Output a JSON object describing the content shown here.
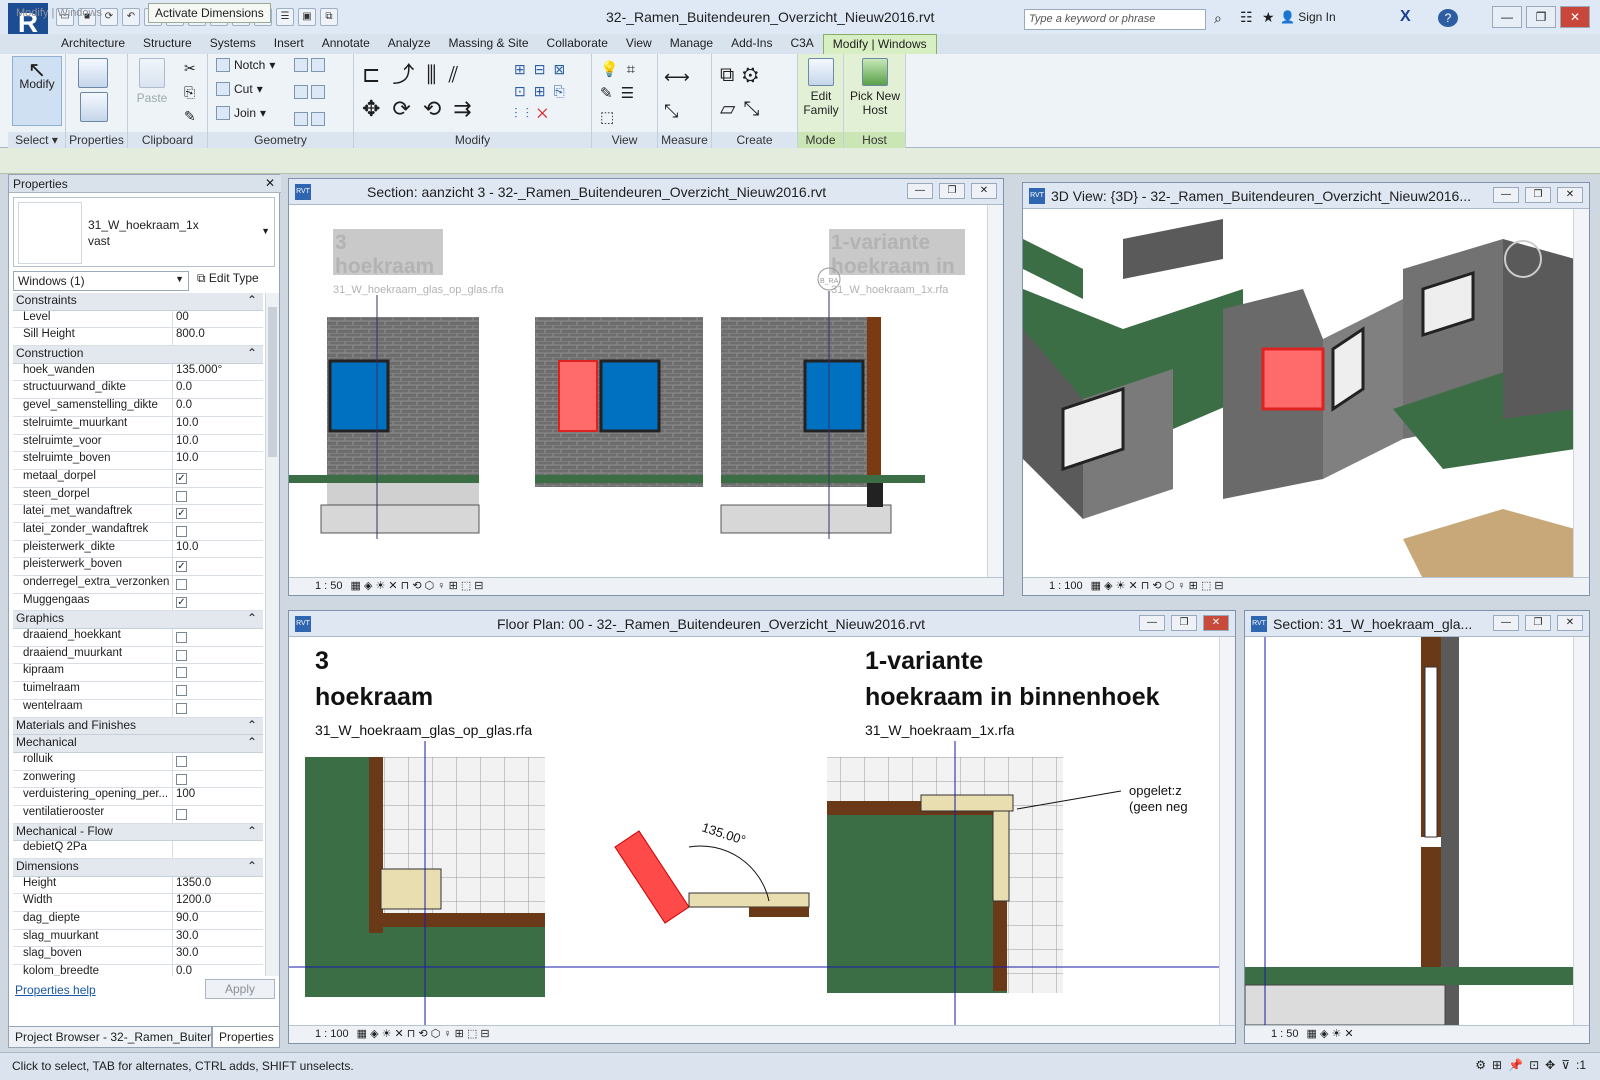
{
  "app": {
    "logo_letter": "R",
    "doc_title": "32-_Ramen_Buitendeuren_Overzicht_Nieuw2016.rvt",
    "search_placeholder": "Type a keyword or phrase",
    "sign_in": "Sign In",
    "help": "?"
  },
  "ribbon_tabs": [
    "Architecture",
    "Structure",
    "Systems",
    "Insert",
    "Annotate",
    "Analyze",
    "Massing & Site",
    "Collaborate",
    "View",
    "Manage",
    "Add-Ins",
    "C3A",
    "Modify | Windows"
  ],
  "ribbon": {
    "modify_label": "Modify",
    "select_label": "Select ▾",
    "properties_label": "Properties",
    "paste_label": "Paste",
    "clipboard_label": "Clipboard",
    "notch_label": "Notch",
    "cut_label": "Cut",
    "join_label": "Join",
    "geometry_label": "Geometry",
    "modify_panel_label": "Modify",
    "view_label": "View",
    "measure_label": "Measure",
    "create_label": "Create",
    "edit_family_label": "Edit Family",
    "mode_label": "Mode",
    "pick_new_host_label": "Pick New Host",
    "host_label": "Host"
  },
  "options_bar": {
    "context": "Modify | Windows",
    "activate_dimensions": "Activate Dimensions"
  },
  "properties": {
    "title": "Properties",
    "type_name": "31_W_hoekraam_1x",
    "type_sub": "vast",
    "instance_filter": "Windows (1)",
    "edit_type": "Edit Type",
    "help_link": "Properties help",
    "apply": "Apply",
    "rows": [
      {
        "g": "Constraints"
      },
      {
        "n": "Level",
        "v": "00"
      },
      {
        "n": "Sill Height",
        "v": "800.0"
      },
      {
        "g": "Construction"
      },
      {
        "n": "hoek_wanden",
        "v": "135.000°"
      },
      {
        "n": "structuurwand_dikte",
        "v": "0.0"
      },
      {
        "n": "gevel_samenstelling_dikte",
        "v": "0.0"
      },
      {
        "n": "stelruimte_muurkant",
        "v": "10.0"
      },
      {
        "n": "stelruimte_voor",
        "v": "10.0"
      },
      {
        "n": "stelruimte_boven",
        "v": "10.0"
      },
      {
        "n": "metaal_dorpel",
        "c": "✓"
      },
      {
        "n": "steen_dorpel",
        "c": ""
      },
      {
        "n": "latei_met_wandaftrek",
        "c": "✓"
      },
      {
        "n": "latei_zonder_wandaftrek",
        "c": ""
      },
      {
        "n": "pleisterwerk_dikte",
        "v": "10.0"
      },
      {
        "n": "pleisterwerk_boven",
        "c": "✓"
      },
      {
        "n": "onderregel_extra_verzonken",
        "c": ""
      },
      {
        "n": "Muggengaas",
        "c": "✓"
      },
      {
        "g": "Graphics"
      },
      {
        "n": "draaiend_hoekkant",
        "c": ""
      },
      {
        "n": "draaiend_muurkant",
        "c": ""
      },
      {
        "n": "kipraam",
        "c": ""
      },
      {
        "n": "tuimelraam",
        "c": ""
      },
      {
        "n": "wentelraam",
        "c": ""
      },
      {
        "g": "Materials and Finishes"
      },
      {
        "g": "Mechanical"
      },
      {
        "n": "rolluik",
        "c": ""
      },
      {
        "n": "zonwering",
        "c": ""
      },
      {
        "n": "verduistering_opening_per...",
        "v": "100"
      },
      {
        "n": "ventilatierooster",
        "c": ""
      },
      {
        "g": "Mechanical - Flow"
      },
      {
        "n": "debietQ 2Pa",
        "v": ""
      },
      {
        "g": "Dimensions"
      },
      {
        "n": "Height",
        "v": "1350.0"
      },
      {
        "n": "Width",
        "v": "1200.0"
      },
      {
        "n": "dag_diepte",
        "v": "90.0"
      },
      {
        "n": "slag_muurkant",
        "v": "30.0"
      },
      {
        "n": "slag_boven",
        "v": "30.0"
      },
      {
        "n": "kolom_breedte",
        "v": "0.0"
      }
    ]
  },
  "bottom_tabs": {
    "project_browser": "Project Browser - 32-_Ramen_Buiten...",
    "properties": "Properties"
  },
  "views": {
    "section1": {
      "title": "Section: aanzicht 3 - 32-_Ramen_Buitendeuren_Overzicht_Nieuw2016.rvt",
      "scale": "1 : 50",
      "label_left_1": "3",
      "label_left_2": "hoekraam",
      "label_left_3": "31_W_hoekraam_glas_op_glas.rfa",
      "label_right_1": "1-variante",
      "label_right_2": "hoekraam in",
      "label_right_3": "31_W_hoekraam_1x.rfa",
      "marker": "B_RA"
    },
    "view3d": {
      "title": "3D View: {3D} - 32-_Ramen_Buitendeuren_Overzicht_Nieuw2016...",
      "scale": "1 : 100"
    },
    "floorplan": {
      "title": "Floor Plan: 00 - 32-_Ramen_Buitendeuren_Overzicht_Nieuw2016.rvt",
      "scale": "1 : 100",
      "left_num": "3",
      "left_title": "hoekraam",
      "left_file": "31_W_hoekraam_glas_op_glas.rfa",
      "right_num": "1-variante",
      "right_title": "hoekraam in binnenhoek",
      "right_file": "31_W_hoekraam_1x.rfa",
      "angle": "135.00°",
      "note_1": "opgelet:z",
      "note_2": "(geen neg"
    },
    "section2": {
      "title": "Section: 31_W_hoekraam_gla...",
      "scale": "1 : 50"
    }
  },
  "status": {
    "text": "Click to select, TAB for alternates, CTRL adds, SHIFT unselects.",
    "filter_count": ":1"
  },
  "colors": {
    "wall": "#6e6e6e",
    "glass": "#0070c0",
    "selected": "#ff4a4a",
    "ground": "#3c6e46",
    "ribbon_ctx": "#d8efc4"
  }
}
